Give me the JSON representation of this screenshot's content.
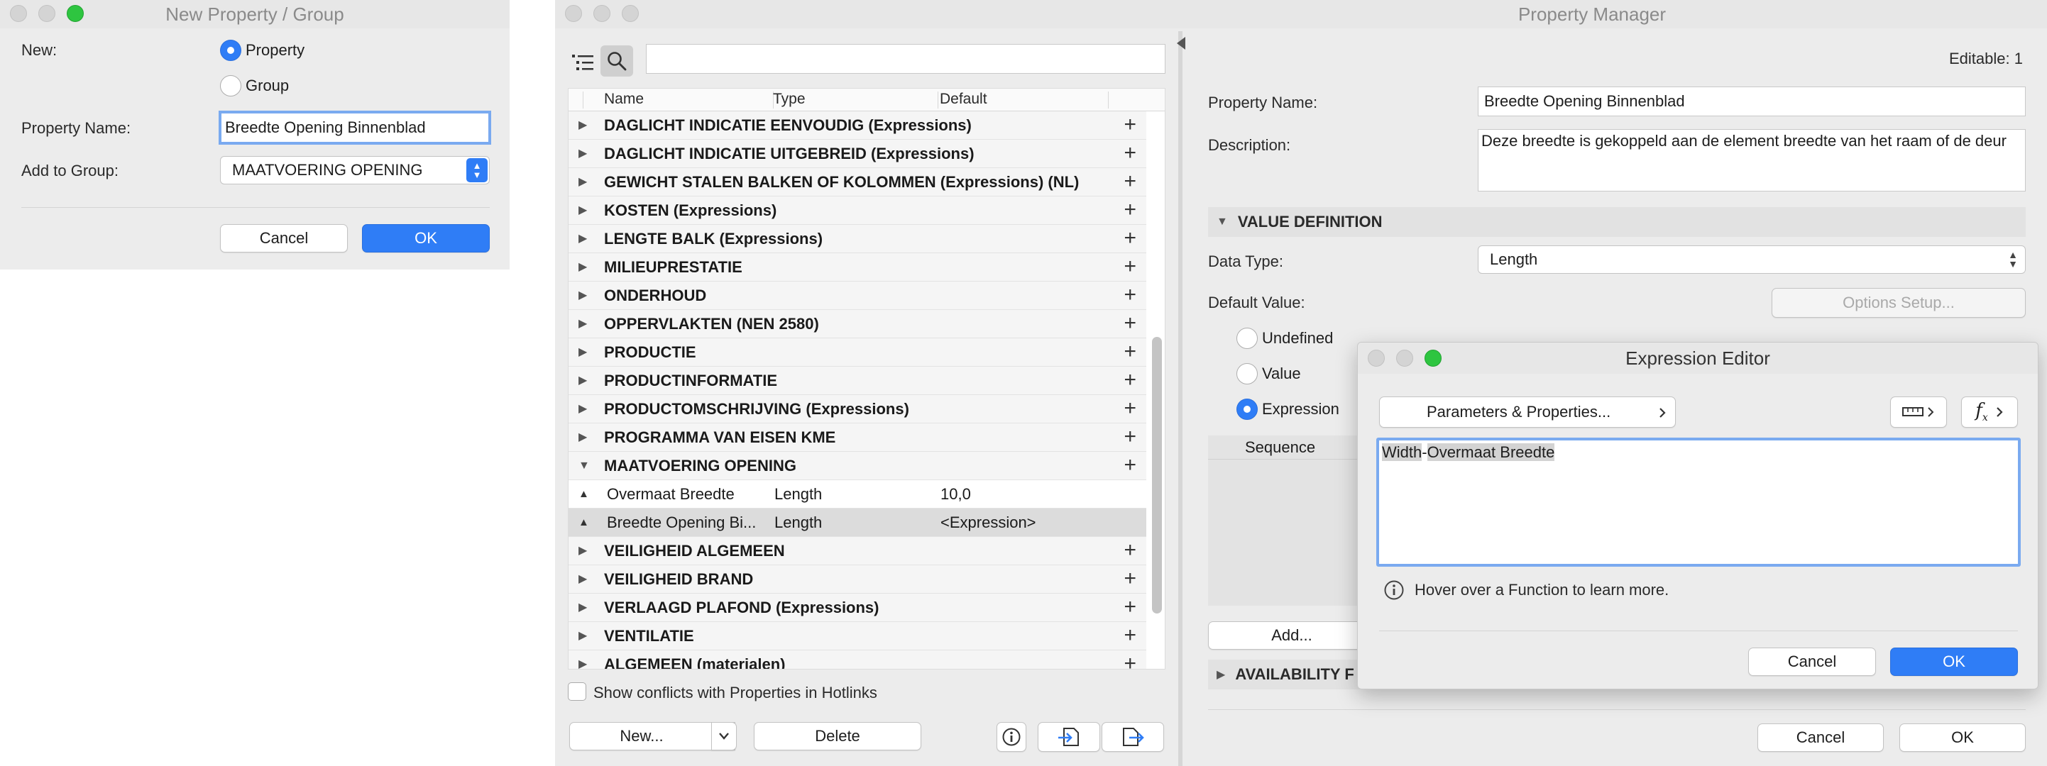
{
  "new_group_dialog": {
    "title": "New Property / Group",
    "new_label": "New:",
    "option_property": "Property",
    "option_group": "Group",
    "name_label": "Property Name:",
    "name_value": "Breedte Opening Binnenblad",
    "group_label": "Add to Group:",
    "group_value": "MAATVOERING OPENING",
    "cancel": "Cancel",
    "ok": "OK"
  },
  "manager": {
    "title": "Property Manager",
    "search": {
      "value": "",
      "placeholder": ""
    },
    "columns": {
      "name": "Name",
      "type": "Type",
      "default": "Default"
    },
    "groups": [
      {
        "name": "DAGLICHT INDICATIE EENVOUDIG (Expressions)"
      },
      {
        "name": "DAGLICHT INDICATIE UITGEBREID (Expressions)"
      },
      {
        "name": "GEWICHT STALEN BALKEN OF KOLOMMEN (Expressions) (NL)"
      },
      {
        "name": "KOSTEN (Expressions)"
      },
      {
        "name": "LENGTE BALK (Expressions)"
      },
      {
        "name": "MILIEUPRESTATIE"
      },
      {
        "name": "ONDERHOUD"
      },
      {
        "name": "OPPERVLAKTEN (NEN 2580)"
      },
      {
        "name": "PRODUCTIE"
      },
      {
        "name": "PRODUCTINFORMATIE"
      },
      {
        "name": "PRODUCTOMSCHRIJVING (Expressions)"
      },
      {
        "name": "PROGRAMMA VAN EISEN KME"
      },
      {
        "name": "MAATVOERING OPENING"
      }
    ],
    "children": [
      {
        "name": "Overmaat Breedte",
        "type": "Length",
        "default": "10,0"
      },
      {
        "name": "Breedte Opening Bi...",
        "type": "Length",
        "default": "<Expression>"
      }
    ],
    "groups_after": [
      {
        "name": "VEILIGHEID ALGEMEEN"
      },
      {
        "name": "VEILIGHEID BRAND"
      },
      {
        "name": "VERLAAGD PLAFOND (Expressions)"
      },
      {
        "name": "VENTILATIE"
      },
      {
        "name": "ALGEMEEN (materialen)"
      }
    ],
    "show_conflicts": "Show conflicts with Properties in Hotlinks",
    "new_button": "New...",
    "delete_button": "Delete",
    "editable": "Editable: 1",
    "prop_name_label": "Property Name:",
    "prop_name_value": "Breedte Opening Binnenblad",
    "description_label": "Description:",
    "description_value": "Deze breedte is gekoppeld aan de element breedte van het raam of de deur",
    "value_definition": "VALUE DEFINITION",
    "data_type_label": "Data Type:",
    "data_type_value": "Length",
    "default_value_label": "Default Value:",
    "options_setup": "Options Setup...",
    "opt_undefined": "Undefined",
    "opt_value": "Value",
    "opt_expression": "Expression",
    "sequence_header": "Sequence",
    "add_button": "Add...",
    "availability": "AVAILABILITY F",
    "cancel": "Cancel",
    "ok": "OK"
  },
  "expression_editor": {
    "title": "Expression Editor",
    "params_button": "Parameters & Properties...",
    "expr_token1": "Width",
    "expr_operator": "-",
    "expr_token2": "Overmaat Breedte",
    "hint": "Hover over a Function to learn more.",
    "cancel": "Cancel",
    "ok": "OK"
  }
}
